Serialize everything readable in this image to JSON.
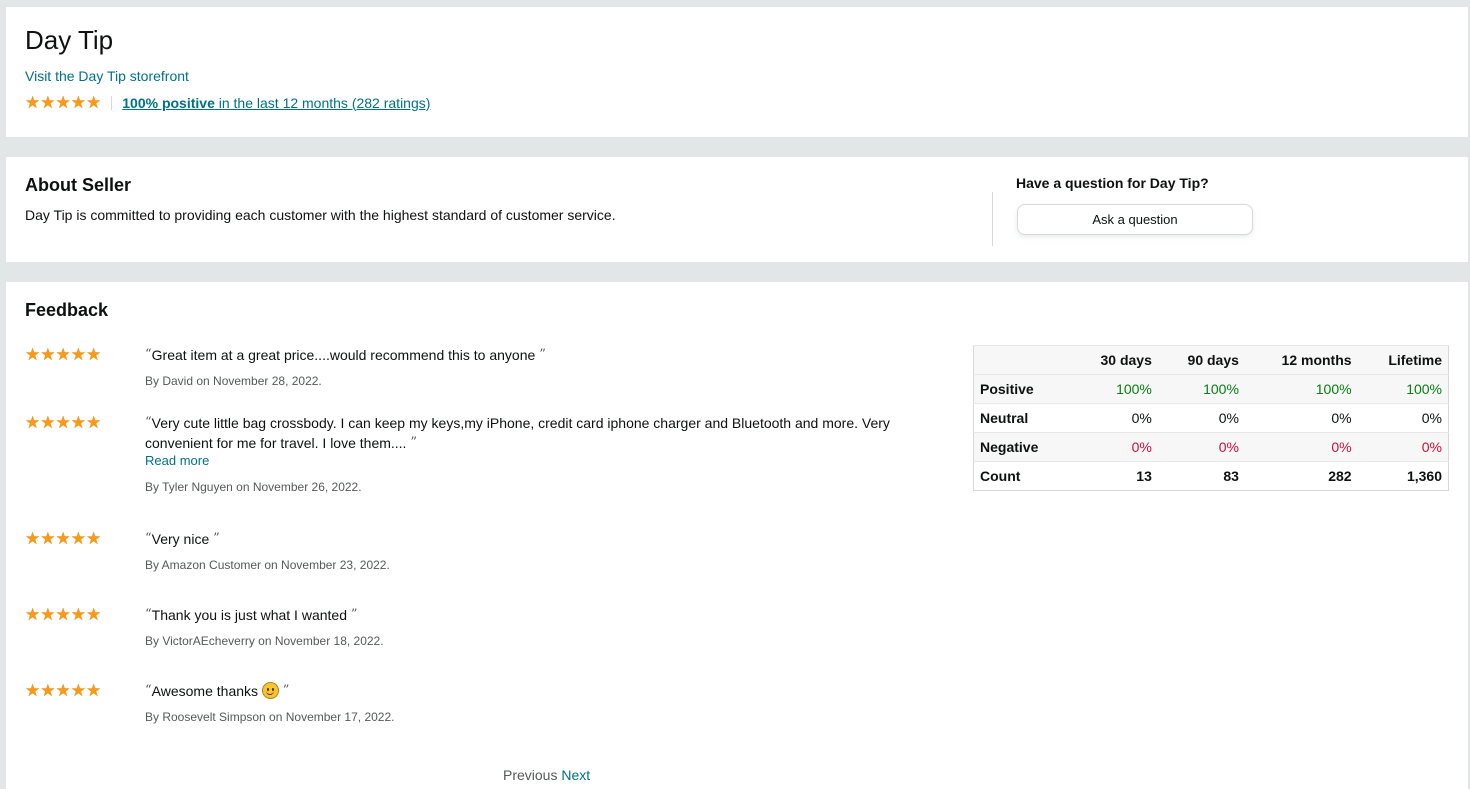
{
  "header": {
    "seller_name": "Day Tip",
    "storefront_link": "Visit the Day Tip storefront",
    "rating_stars": 5,
    "positive_pct": "100% positive",
    "rating_suffix": " in the last 12 months (282 ratings)"
  },
  "about": {
    "title": "About Seller",
    "description": "Day Tip is committed to providing each customer with the highest standard of customer service.",
    "question_label": "Have a question for Day Tip?",
    "ask_button": "Ask a question"
  },
  "feedback": {
    "title": "Feedback",
    "reviews": [
      {
        "stars": 5,
        "comment": "Great item at a great price....would recommend this to anyone",
        "byline": "By David on November 28, 2022."
      },
      {
        "stars": 5,
        "comment": "Very cute little bag crossbody. I can keep my keys,my iPhone, credit card iphone charger and Bluetooth and more. Very convenient for me for travel. I love them....",
        "read_more": "Read more",
        "byline": "By Tyler Nguyen on November 26, 2022."
      },
      {
        "stars": 5,
        "comment": "Very nice",
        "byline": "By Amazon Customer on November 23, 2022."
      },
      {
        "stars": 5,
        "comment": "Thank you is just what I wanted",
        "byline": "By VictorAEcheverry on November 18, 2022."
      },
      {
        "stars": 5,
        "comment": "Awesome thanks ",
        "emoji": "smiling-face-icon",
        "byline": "By Roosevelt Simpson on November 17, 2022."
      }
    ],
    "pager": {
      "previous": "Previous",
      "next": "Next"
    },
    "table": {
      "headers": [
        "",
        "30 days",
        "90 days",
        "12 months",
        "Lifetime"
      ],
      "rows": [
        {
          "label": "Positive",
          "values": [
            "100%",
            "100%",
            "100%",
            "100%"
          ]
        },
        {
          "label": "Neutral",
          "values": [
            "0%",
            "0%",
            "0%",
            "0%"
          ]
        },
        {
          "label": "Negative",
          "values": [
            "0%",
            "0%",
            "0%",
            "0%"
          ]
        },
        {
          "label": "Count",
          "values": [
            "13",
            "83",
            "282",
            "1,360"
          ]
        }
      ]
    }
  },
  "colors": {
    "link": "#007185",
    "star": "#f79a16",
    "positive": "#067d0f",
    "negative": "#cc0c39"
  }
}
